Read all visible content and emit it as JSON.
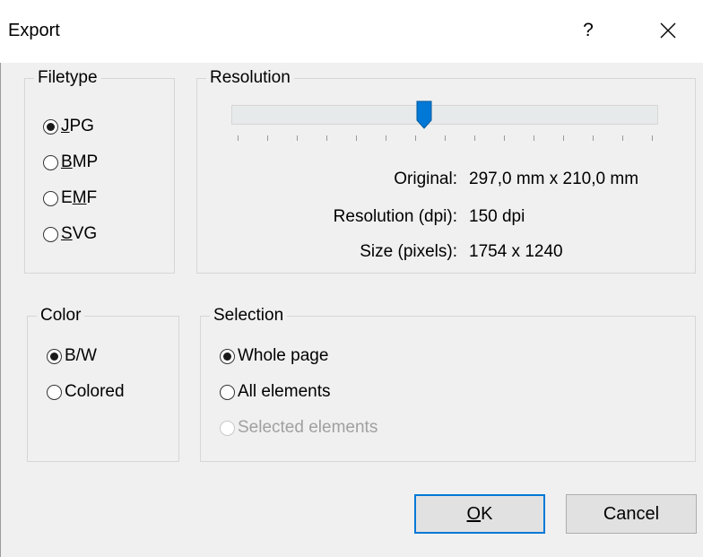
{
  "window": {
    "title": "Export",
    "help_glyph": "?",
    "close_icon": "close-icon"
  },
  "filetype": {
    "label": "Filetype",
    "options": [
      {
        "pre": "",
        "accel": "J",
        "post": "PG",
        "selected": true
      },
      {
        "pre": "",
        "accel": "B",
        "post": "MP",
        "selected": false
      },
      {
        "pre": "E",
        "accel": "M",
        "post": "F",
        "selected": false
      },
      {
        "pre": "",
        "accel": "S",
        "post": "VG",
        "selected": false
      }
    ]
  },
  "resolution": {
    "label": "Resolution",
    "slider_fraction": 0.45,
    "tick_count": 15,
    "original_label": "Original:",
    "original_value": "297,0 mm x 210,0 mm",
    "dpi_label": "Resolution (dpi):",
    "dpi_value": "150 dpi",
    "size_label": "Size (pixels):",
    "size_value": "1754 x 1240"
  },
  "color": {
    "label": "Color",
    "options": [
      {
        "label": "B/W",
        "selected": true
      },
      {
        "label": "Colored",
        "selected": false
      }
    ]
  },
  "selection": {
    "label": "Selection",
    "options": [
      {
        "label": "Whole page",
        "selected": true,
        "disabled": false
      },
      {
        "label": "All elements",
        "selected": false,
        "disabled": false
      },
      {
        "label": "Selected elements",
        "selected": false,
        "disabled": true
      }
    ]
  },
  "buttons": {
    "ok_accel": "O",
    "ok_rest": "K",
    "cancel": "Cancel"
  }
}
